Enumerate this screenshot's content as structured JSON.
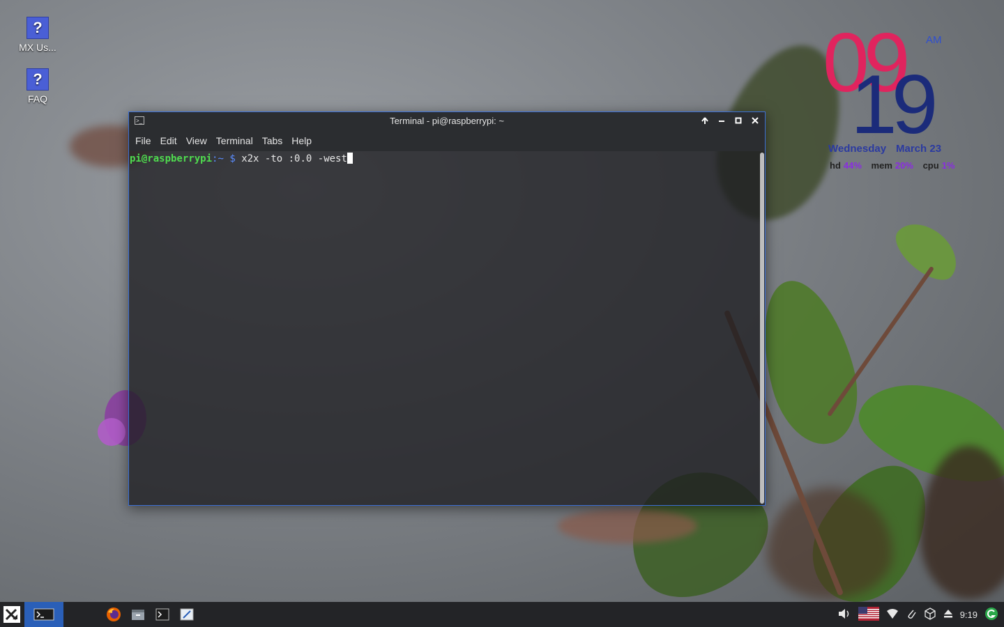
{
  "desktop": {
    "icons": [
      {
        "label": "MX Us...",
        "glyph": "?"
      },
      {
        "label": "FAQ",
        "glyph": "?"
      }
    ]
  },
  "conky": {
    "hour": "09",
    "minute": "19",
    "ampm": "AM",
    "weekday": "Wednesday",
    "date": "March 23",
    "stats": [
      {
        "label": "hd",
        "value": "44%"
      },
      {
        "label": "mem",
        "value": "20%"
      },
      {
        "label": "cpu",
        "value": "1%"
      }
    ],
    "colors": {
      "hour": "#e0245e",
      "minute": "#1b2b7a"
    }
  },
  "terminal": {
    "title": "Terminal - pi@raspberrypi: ~",
    "menu": [
      "File",
      "Edit",
      "View",
      "Terminal",
      "Tabs",
      "Help"
    ],
    "prompt_user": "pi@raspberrypi",
    "prompt_path": ":~",
    "prompt_symbol": "$",
    "command": "x2x -to :0.0 -west",
    "window_buttons": [
      "keep-on-top",
      "minimize",
      "maximize",
      "close"
    ]
  },
  "taskbar": {
    "launchers": [
      "firefox-icon",
      "file-manager-icon",
      "terminal-icon",
      "text-editor-icon"
    ],
    "tray": {
      "clock": "9:19",
      "keyboard_layout": "us-flag-icon"
    },
    "colors": {
      "accent": "#3b6fd6",
      "active_task": "#2a5fb8"
    }
  }
}
